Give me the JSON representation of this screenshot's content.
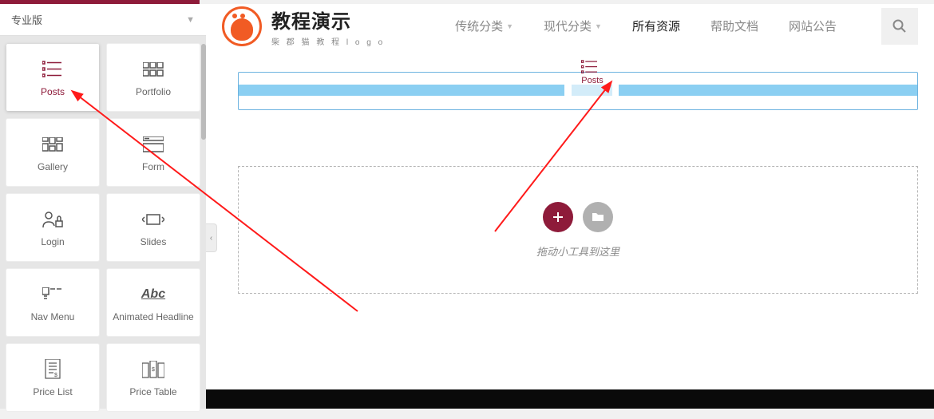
{
  "sidebar": {
    "section_title": "专业版",
    "widgets": [
      {
        "label": "Posts",
        "icon": "posts-list-icon",
        "active": true
      },
      {
        "label": "Portfolio",
        "icon": "portfolio-grid-icon",
        "active": false
      },
      {
        "label": "Gallery",
        "icon": "gallery-masonry-icon",
        "active": false
      },
      {
        "label": "Form",
        "icon": "form-stack-icon",
        "active": false
      },
      {
        "label": "Login",
        "icon": "login-lock-icon",
        "active": false
      },
      {
        "label": "Slides",
        "icon": "slides-arrows-icon",
        "active": false
      },
      {
        "label": "Nav Menu",
        "icon": "nav-menu-icon",
        "active": false
      },
      {
        "label": "Animated Headline",
        "icon": "animated-text-icon",
        "active": false
      },
      {
        "label": "Price List",
        "icon": "price-list-icon",
        "active": false
      },
      {
        "label": "Price Table",
        "icon": "price-table-icon",
        "active": false
      }
    ]
  },
  "site": {
    "logo_title": "教程演示",
    "logo_sub": "柴 郡 猫 教 程 l o g o",
    "nav": [
      {
        "label": "传统分类",
        "caret": true,
        "active": false
      },
      {
        "label": "现代分类",
        "caret": true,
        "active": false
      },
      {
        "label": "所有资源",
        "caret": false,
        "active": true
      },
      {
        "label": "帮助文档",
        "caret": false,
        "active": false
      },
      {
        "label": "网站公告",
        "caret": false,
        "active": false
      }
    ]
  },
  "canvas": {
    "ghost_label": "Posts",
    "empty_hint": "拖动小工具到这里"
  },
  "colors": {
    "brand": "#8e1b3a",
    "accent_orange": "#f15b24",
    "drop_blue": "#8bcff2"
  }
}
